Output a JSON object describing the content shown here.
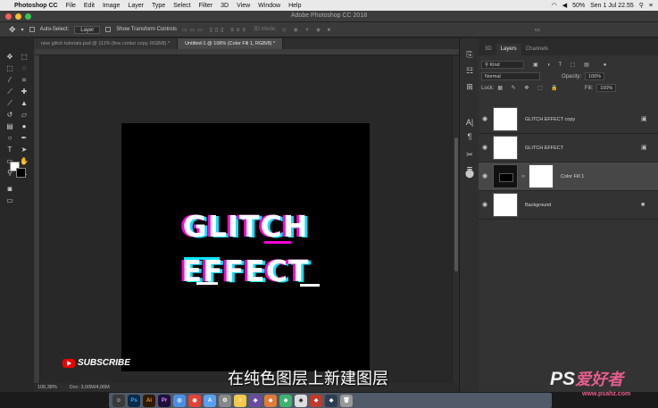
{
  "menubar": {
    "app": "Photoshop CC",
    "items": [
      "File",
      "Edit",
      "Image",
      "Layer",
      "Type",
      "Select",
      "Filter",
      "3D",
      "View",
      "Window",
      "Help"
    ],
    "battery": "50%",
    "clock": "Sen 1 Jul  22.55"
  },
  "window": {
    "title": "Adobe Photoshop CC 2018"
  },
  "options": {
    "auto_select_label": "Auto-Select:",
    "auto_select_value": "Layer",
    "transform_label": "Show Transform Controls",
    "mode3d": "3D Mode:"
  },
  "tabs": [
    {
      "label": "new glitch tutorials.psd @ 111% (line contur copy, RGB/8) *",
      "active": false
    },
    {
      "label": "Untitled-1 @ 106% (Color Fill 1, RGB/8) *",
      "active": true
    }
  ],
  "canvas": {
    "line1": "GLITCH",
    "line2": "EFFECT"
  },
  "status": {
    "zoom": "106,38%",
    "doc": "Doc: 3,00M/4,00M"
  },
  "overlay": {
    "subscribe": "SUBSCRIBE",
    "subtitle": "在纯色图层上新建图层",
    "watermark_brand": "PS",
    "watermark_cn": "爱好者",
    "watermark_url": "www.psahz.com"
  },
  "panel": {
    "tabs": [
      "3D",
      "Layers",
      "Channels"
    ],
    "active_tab": "Layers",
    "filter_kind": "Kind",
    "blend_mode": "Normal",
    "opacity_label": "Opacity:",
    "opacity": "100%",
    "lock_label": "Lock:",
    "fill_label": "Fill:",
    "fill": "100%",
    "layers": [
      {
        "name": "GLITCH EFFECT copy",
        "selected": false
      },
      {
        "name": "GLITCH EFFECT",
        "selected": false
      },
      {
        "name": "Color Fill 1",
        "selected": true
      },
      {
        "name": "Background",
        "selected": false
      }
    ]
  },
  "colors": {
    "glitch_magenta": "#ff00d4",
    "glitch_cyan": "#00e5ff",
    "selected_layer": "#474747"
  }
}
